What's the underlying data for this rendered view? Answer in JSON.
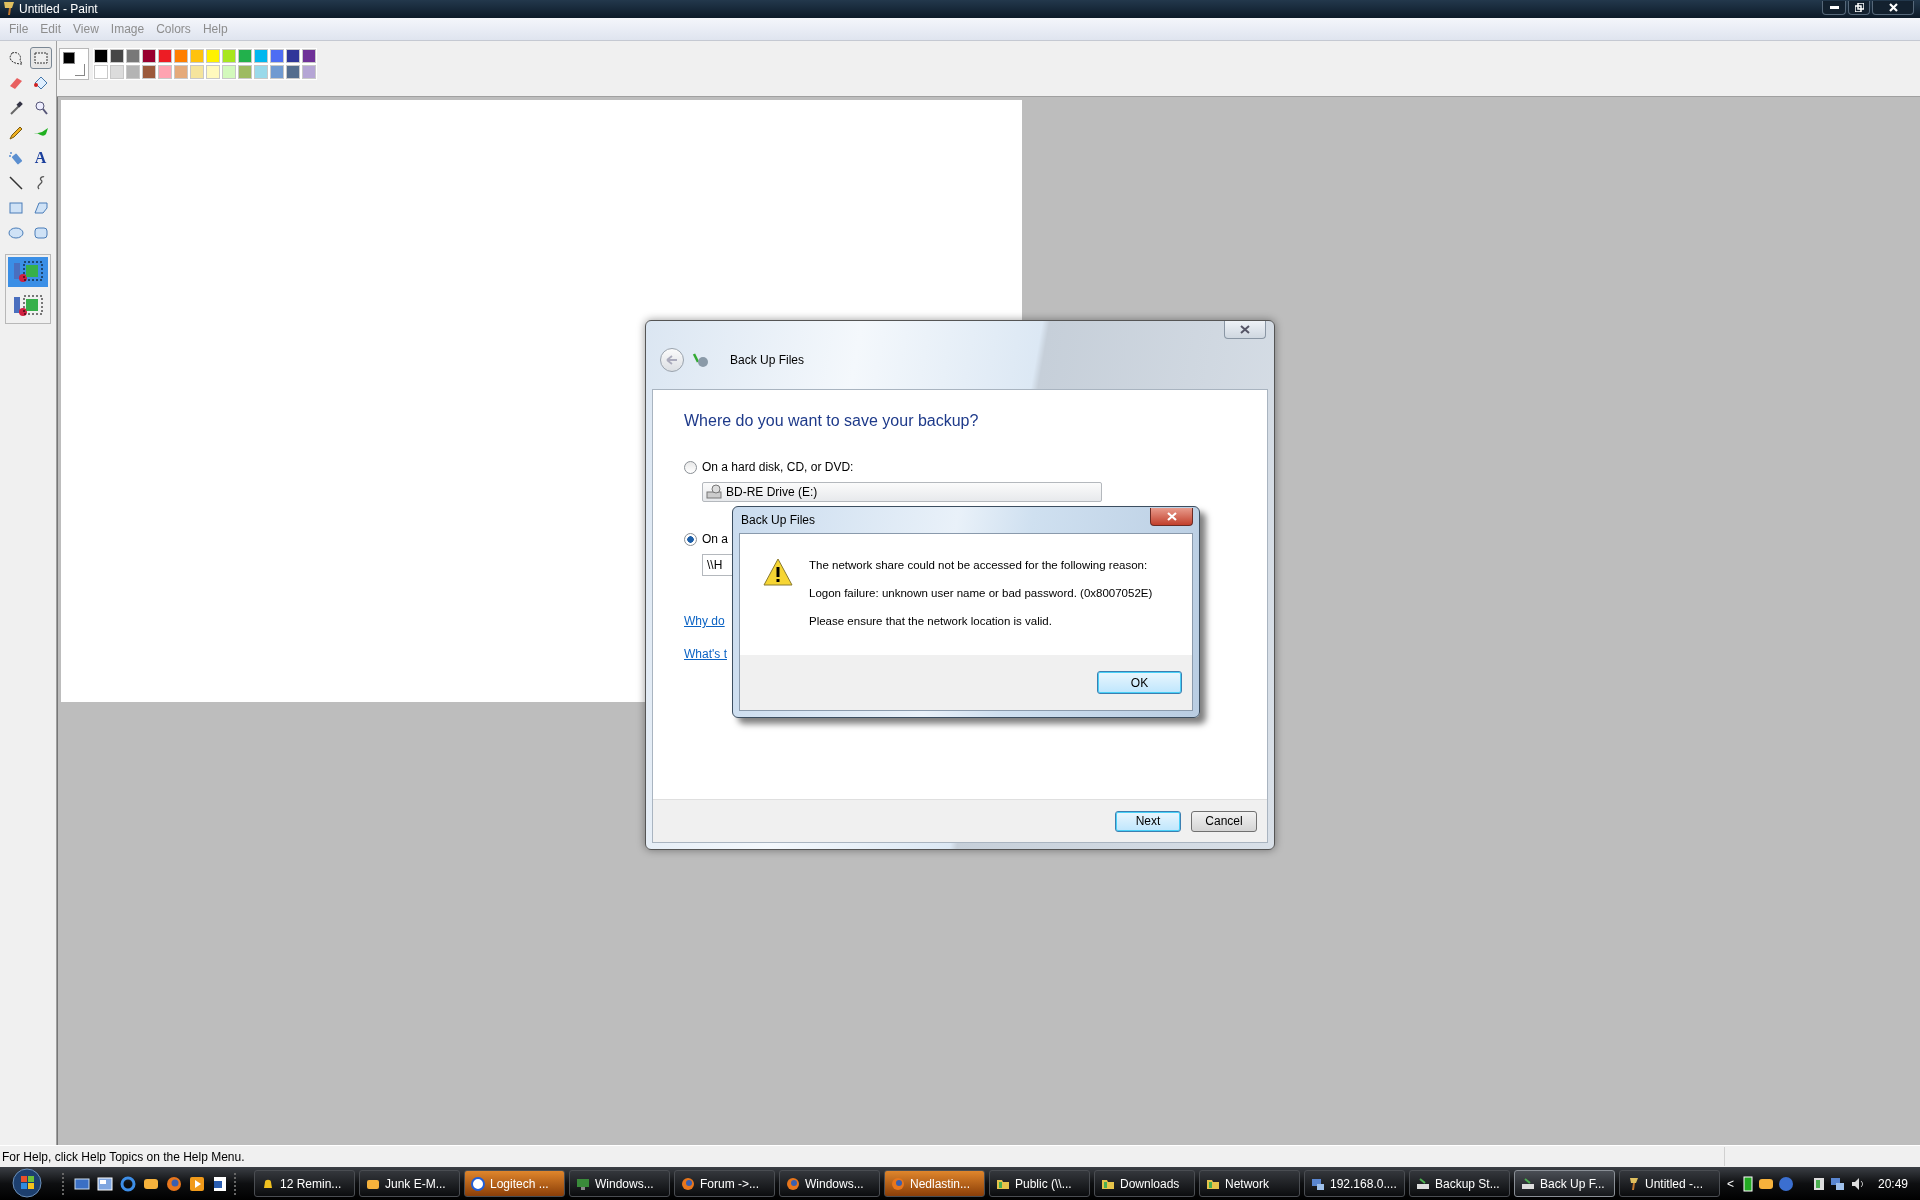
{
  "window": {
    "title": "Untitled - Paint"
  },
  "menu": [
    "File",
    "Edit",
    "View",
    "Image",
    "Colors",
    "Help"
  ],
  "tools": [
    {
      "selected": false
    },
    {
      "selected": true
    },
    {
      "selected": false
    },
    {
      "selected": false
    },
    {
      "selected": false
    },
    {
      "selected": false
    },
    {
      "selected": false
    },
    {
      "selected": false
    },
    {
      "selected": false
    },
    {
      "selected": false,
      "glyph": "A"
    },
    {
      "selected": false
    },
    {
      "selected": false
    },
    {
      "selected": false
    },
    {
      "selected": false
    },
    {
      "selected": false
    },
    {
      "selected": false
    }
  ],
  "tool_options": [
    {
      "selected": true
    },
    {
      "selected": false
    }
  ],
  "current_colors": [
    {
      "color": "#000000"
    },
    {
      "color": "#ffffff"
    }
  ],
  "palette": [
    {
      "color": "#000000"
    },
    {
      "color": "#464646"
    },
    {
      "color": "#787878"
    },
    {
      "color": "#990030"
    },
    {
      "color": "#ed1c24"
    },
    {
      "color": "#ff7e00"
    },
    {
      "color": "#ffc20e"
    },
    {
      "color": "#fff200"
    },
    {
      "color": "#a8e61d"
    },
    {
      "color": "#22b14c"
    },
    {
      "color": "#00b7ef"
    },
    {
      "color": "#4d6df3"
    },
    {
      "color": "#2f3699"
    },
    {
      "color": "#6f3198"
    },
    {
      "color": "#ffffff"
    },
    {
      "color": "#dcdcdc"
    },
    {
      "color": "#b4b4b4"
    },
    {
      "color": "#9c5a3c"
    },
    {
      "color": "#ffa3b1"
    },
    {
      "color": "#e5aa7a"
    },
    {
      "color": "#f5e49c"
    },
    {
      "color": "#fff9bd"
    },
    {
      "color": "#d3f9bc"
    },
    {
      "color": "#9dbb61"
    },
    {
      "color": "#99d9ea"
    },
    {
      "color": "#709ad1"
    },
    {
      "color": "#546d8e"
    },
    {
      "color": "#b5a5d5"
    }
  ],
  "status_bar": "For Help, click Help Topics on the Help Menu.",
  "backup_wizard": {
    "title": "Back Up Files",
    "heading": "Where do you want to save your backup?",
    "options": [
      {
        "label": "On a hard disk, CD, or DVD:",
        "selected": false,
        "kind": "dropdown",
        "value": "BD-RE Drive (E:)"
      },
      {
        "label": "On a",
        "selected": true,
        "kind": "field",
        "value": "\\\\H"
      }
    ],
    "links": [
      "Why do",
      "What's t"
    ],
    "buttons": [
      {
        "label": "Next",
        "default": true
      },
      {
        "label": "Cancel",
        "default": false
      }
    ]
  },
  "error_dialog": {
    "title": "Back Up Files",
    "messages": [
      "The network share could not be accessed for the following reason:",
      "Logon failure: unknown user name or bad password. (0x8007052E)",
      "Please ensure that the network location is valid."
    ],
    "buttons": [
      {
        "label": "OK",
        "default": true
      }
    ]
  },
  "taskbar": {
    "items": [
      {
        "label": "12 Remin...",
        "selected": false,
        "flashing": false
      },
      {
        "label": "Junk E-M...",
        "selected": false,
        "flashing": false
      },
      {
        "label": "Logitech ...",
        "selected": false,
        "flashing": true
      },
      {
        "label": "Windows...",
        "selected": false,
        "flashing": false
      },
      {
        "label": "Forum ->...",
        "selected": false,
        "flashing": false
      },
      {
        "label": "Windows...",
        "selected": false,
        "flashing": false
      },
      {
        "label": "Nedlastin...",
        "selected": false,
        "flashing": true
      },
      {
        "label": "Public (\\\\...",
        "selected": false,
        "flashing": false
      },
      {
        "label": "Downloads",
        "selected": false,
        "flashing": false
      },
      {
        "label": "Network",
        "selected": false,
        "flashing": false
      },
      {
        "label": "192.168.0....",
        "selected": false,
        "flashing": false
      },
      {
        "label": "Backup St...",
        "selected": false,
        "flashing": false
      },
      {
        "label": "Back Up F...",
        "selected": true,
        "flashing": false
      },
      {
        "label": "Untitled -...",
        "selected": false,
        "flashing": false
      }
    ],
    "tray_toggle": "<",
    "clock": "20:49"
  }
}
